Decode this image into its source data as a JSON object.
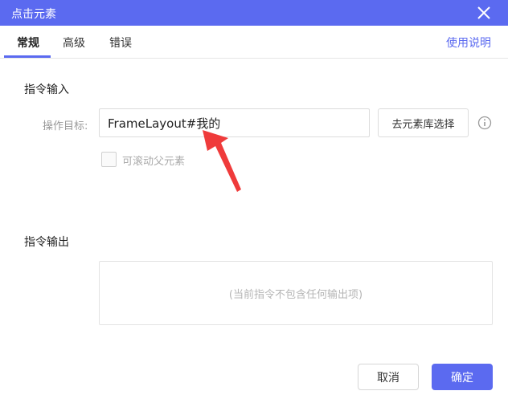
{
  "window": {
    "title": "点击元素"
  },
  "tabs": [
    {
      "label": "常规"
    },
    {
      "label": "高级"
    },
    {
      "label": "错误"
    }
  ],
  "help_link": "使用说明",
  "input_section": {
    "title": "指令输入",
    "target_label": "操作目标:",
    "target_value": "FrameLayout#我的",
    "pick_button": "去元素库选择",
    "scrollable_parent_label": "可滚动父元素"
  },
  "output_section": {
    "title": "指令输出",
    "empty_text": "(当前指令不包含任何输出项)"
  },
  "footer": {
    "cancel_label": "取消",
    "confirm_label": "确定"
  },
  "colors": {
    "accent": "#5b6af0",
    "annotation_arrow": "#ef3b3b"
  }
}
